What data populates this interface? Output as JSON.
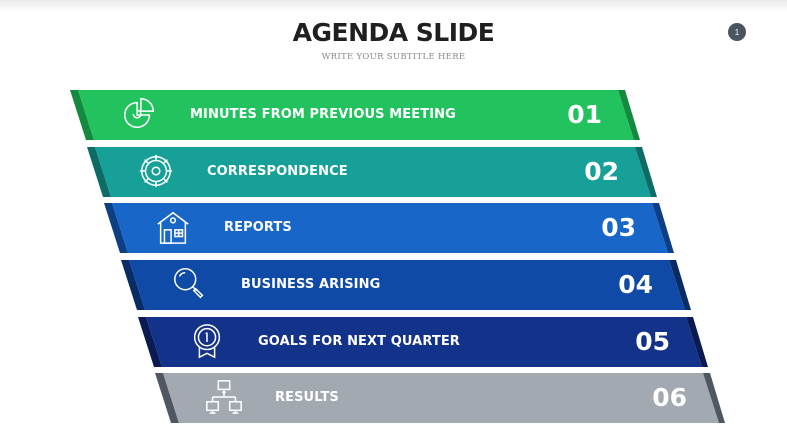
{
  "header": {
    "title": "AGENDA SLIDE",
    "subtitle": "WRITE YOUR SUBTITLE HERE",
    "page_number": "1"
  },
  "agenda": [
    {
      "label": "MINUTES FROM PREVIOUS MEETING",
      "number": "01",
      "icon": "pie-chart-icon",
      "color": "#22c35e",
      "edge_color": "#138a3d"
    },
    {
      "label": "CORRESPONDENCE",
      "number": "02",
      "icon": "gear-icon",
      "color": "#17a097",
      "edge_color": "#0e6c66"
    },
    {
      "label": "REPORTS",
      "number": "03",
      "icon": "house-icon",
      "color": "#1766c8",
      "edge_color": "#0c3f86"
    },
    {
      "label": "BUSINESS ARISING",
      "number": "04",
      "icon": "magnifier-icon",
      "color": "#0f4aa6",
      "edge_color": "#0a2c66"
    },
    {
      "label": "GOALS FOR NEXT QUARTER",
      "number": "05",
      "icon": "award-icon",
      "color": "#13328a",
      "edge_color": "#0a1a52"
    },
    {
      "label": "RESULTS",
      "number": "06",
      "icon": "network-icon",
      "color": "#a3a9b1",
      "edge_color": "#4f5862"
    }
  ]
}
